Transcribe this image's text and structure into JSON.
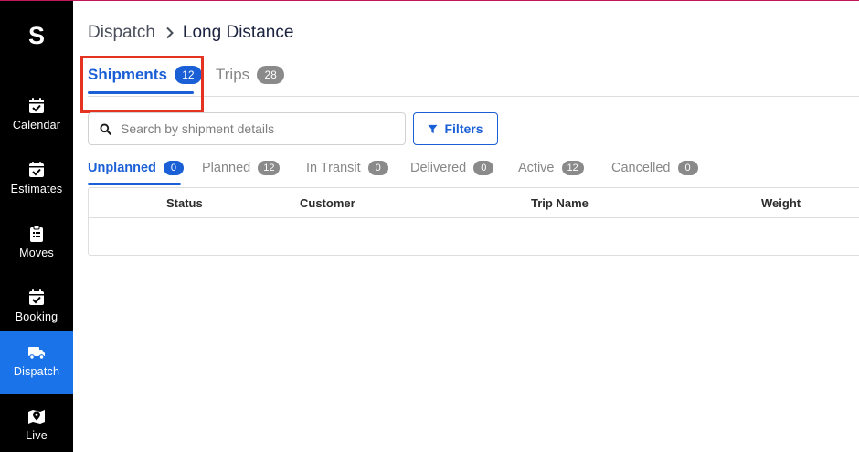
{
  "app": {
    "logo_letter": "S"
  },
  "sidebar": {
    "items": [
      {
        "label": "Calendar",
        "icon": "calendar-check-icon",
        "active": false
      },
      {
        "label": "Estimates",
        "icon": "calendar-check-icon",
        "active": false
      },
      {
        "label": "Moves",
        "icon": "clipboard-list-icon",
        "active": false
      },
      {
        "label": "Booking",
        "icon": "calendar-check-icon",
        "active": false
      },
      {
        "label": "Dispatch",
        "icon": "truck-icon",
        "active": true
      },
      {
        "label": "Live",
        "icon": "map-pin-icon",
        "active": false
      }
    ]
  },
  "breadcrumb": {
    "parent": "Dispatch",
    "current": "Long Distance"
  },
  "tabs": [
    {
      "label": "Shipments",
      "count": "12",
      "active": true
    },
    {
      "label": "Trips",
      "count": "28",
      "active": false
    }
  ],
  "search": {
    "placeholder": "Search by shipment details",
    "value": ""
  },
  "filters": {
    "label": "Filters"
  },
  "status_tabs": [
    {
      "label": "Unplanned",
      "count": "0",
      "active": true
    },
    {
      "label": "Planned",
      "count": "12",
      "active": false
    },
    {
      "label": "In Transit",
      "count": "0",
      "active": false
    },
    {
      "label": "Delivered",
      "count": "0",
      "active": false
    },
    {
      "label": "Active",
      "count": "12",
      "active": false
    },
    {
      "label": "Cancelled",
      "count": "0",
      "active": false
    }
  ],
  "table": {
    "columns": [
      "Status",
      "Customer",
      "Trip Name",
      "Weight"
    ],
    "rows": []
  },
  "colors": {
    "sidebar_bg": "#000000",
    "active_nav": "#1a73e8",
    "accent": "#1a5fd6",
    "badge_inactive": "#8a8a8a",
    "highlight": "#e53322"
  }
}
